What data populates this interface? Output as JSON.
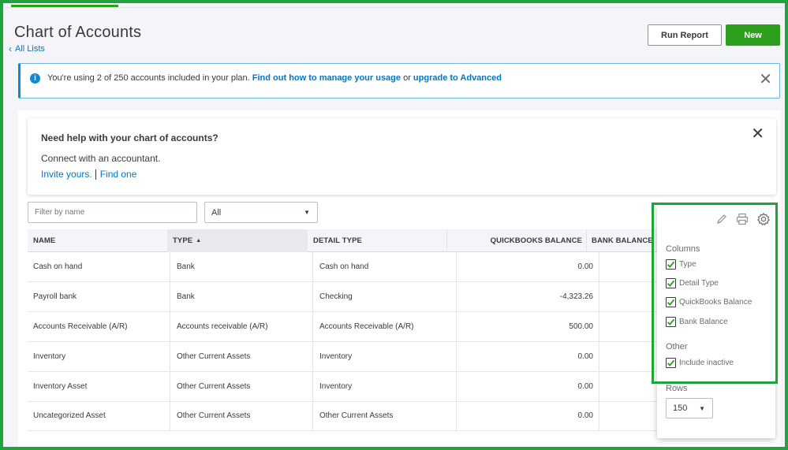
{
  "header": {
    "title": "Chart of Accounts",
    "back_link": "All Lists",
    "run_report_label": "Run Report",
    "new_label": "New"
  },
  "banner": {
    "text_prefix": "You're using 2 of 250 accounts included in your plan.",
    "link_manage": "Find out how to manage your usage",
    "text_or": "or",
    "link_upgrade": "upgrade to Advanced"
  },
  "help_card": {
    "title": "Need help with your chart of accounts?",
    "subtitle": "Connect with an accountant.",
    "link_invite": "Invite yours.",
    "link_find": "Find one"
  },
  "filters": {
    "name_placeholder": "Filter by name",
    "type_value": "All"
  },
  "table": {
    "columns": [
      "NAME",
      "TYPE",
      "DETAIL TYPE",
      "QUICKBOOKS BALANCE",
      "BANK BALANCE"
    ],
    "sort_indicator": "▲",
    "rows": [
      {
        "name": "Cash on hand",
        "type": "Bank",
        "detail": "Cash on hand",
        "qb_balance": "0.00"
      },
      {
        "name": "Payroll bank",
        "type": "Bank",
        "detail": "Checking",
        "qb_balance": "-4,323.26"
      },
      {
        "name": "Accounts Receivable (A/R)",
        "type": "Accounts receivable (A/R)",
        "detail": "Accounts Receivable (A/R)",
        "qb_balance": "500.00"
      },
      {
        "name": "Inventory",
        "type": "Other Current Assets",
        "detail": "Inventory",
        "qb_balance": "0.00"
      },
      {
        "name": "Inventory Asset",
        "type": "Other Current Assets",
        "detail": "Inventory",
        "qb_balance": "0.00"
      },
      {
        "name": "Uncategorized Asset",
        "type": "Other Current Assets",
        "detail": "Other Current Assets",
        "qb_balance": "0.00"
      }
    ]
  },
  "settings_panel": {
    "icons": [
      "pencil-icon",
      "printer-icon",
      "gear-icon"
    ],
    "columns_heading": "Columns",
    "columns": [
      {
        "label": "Type",
        "checked": true
      },
      {
        "label": "Detail Type",
        "checked": true
      },
      {
        "label": "QuickBooks Balance",
        "checked": true
      },
      {
        "label": "Bank Balance",
        "checked": true
      }
    ],
    "other_heading": "Other",
    "other": [
      {
        "label": "Include inactive",
        "checked": true
      }
    ],
    "rows_heading": "Rows",
    "rows_value": "150"
  },
  "colors": {
    "accent_green": "#2ca01c",
    "highlight_green": "#1fa33c",
    "link_blue": "#0077c5",
    "info_blue": "#0d8ad6",
    "text": "#393a3d"
  }
}
